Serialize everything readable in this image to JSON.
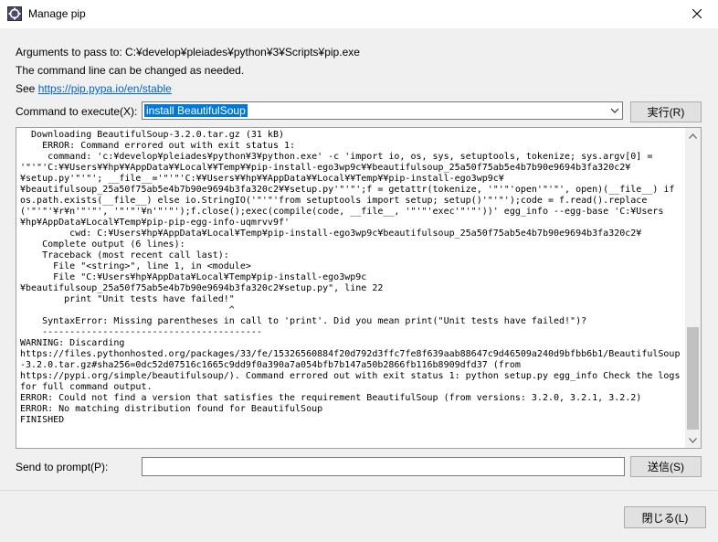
{
  "window": {
    "title": "Manage pip"
  },
  "info": {
    "arguments": "Arguments to pass to: C:¥develop¥pleiades¥python¥3¥Scripts¥pip.exe",
    "note": "The command line can be changed as needed.",
    "see_label": "See",
    "see_link": "https://pip.pypa.io/en/stable"
  },
  "command": {
    "label": "Command to execute(X):",
    "value": "install BeautifulSoup",
    "run_label": "実行(R)"
  },
  "output": {
    "text": "  Downloading BeautifulSoup-3.2.0.tar.gz (31 kB)\n    ERROR: Command errored out with exit status 1:\n     command: 'c:¥develop¥pleiades¥python¥3¥python.exe' -c 'import io, os, sys, setuptools, tokenize; sys.argv[0] =\n'\"'\"'C:¥¥Users¥¥hp¥¥AppData¥¥Local¥¥Temp¥¥pip-install-ego3wp9c¥¥beautifulsoup_25a50f75ab5e4b7b90e9694b3fa320c2¥\n¥setup.py'\"'\"'; __file__='\"'\"'C:¥¥Users¥¥hp¥¥AppData¥¥Local¥¥Temp¥¥pip-install-ego3wp9c¥\n¥beautifulsoup_25a50f75ab5e4b7b90e9694b3fa320c2¥¥setup.py'\"'\"';f = getattr(tokenize, '\"'\"'open'\"'\"', open)(__file__) if\nos.path.exists(__file__) else io.StringIO('\"'\"'from setuptools import setup; setup()'\"'\"');code = f.read().replace\n('\"'\"'¥r¥n'\"'\"', '\"'\"'¥n'\"'\"');f.close();exec(compile(code, __file__, '\"'\"'exec'\"'\"'))' egg_info --egg-base 'C:¥Users\n¥hp¥AppData¥Local¥Temp¥pip-pip-egg-info-uqmrvv9f'\n         cwd: C:¥Users¥hp¥AppData¥Local¥Temp¥pip-install-ego3wp9c¥beautifulsoup_25a50f75ab5e4b7b90e9694b3fa320c2¥\n    Complete output (6 lines):\n    Traceback (most recent call last):\n      File \"<string>\", line 1, in <module>\n      File \"C:¥Users¥hp¥AppData¥Local¥Temp¥pip-install-ego3wp9c\n¥beautifulsoup_25a50f75ab5e4b7b90e9694b3fa320c2¥setup.py\", line 22\n        print \"Unit tests have failed!\"\n                                      ^\n    SyntaxError: Missing parentheses in call to 'print'. Did you mean print(\"Unit tests have failed!\")?\n    ----------------------------------------\nWARNING: Discarding\nhttps://files.pythonhosted.org/packages/33/fe/15326560884f20d792d3ffc7fe8f639aab88647c9d46509a240d9bfbb6b1/BeautifulSoup\n-3.2.0.tar.gz#sha256=0dc52d07516c1665c9dd9f0a390a7a054bfb7b147a50b2866fb116b8909dfd37 (from\nhttps://pypi.org/simple/beautifulsoup/). Command errored out with exit status 1: python setup.py egg_info Check the logs\nfor full command output.\nERROR: Could not find a version that satisfies the requirement BeautifulSoup (from versions: 3.2.0, 3.2.1, 3.2.2)\nERROR: No matching distribution found for BeautifulSoup\nFINISHED"
  },
  "prompt": {
    "label": "Send to prompt(P):",
    "value": "",
    "send_label": "送信(S)"
  },
  "footer": {
    "close_label": "閉じる(L)"
  }
}
